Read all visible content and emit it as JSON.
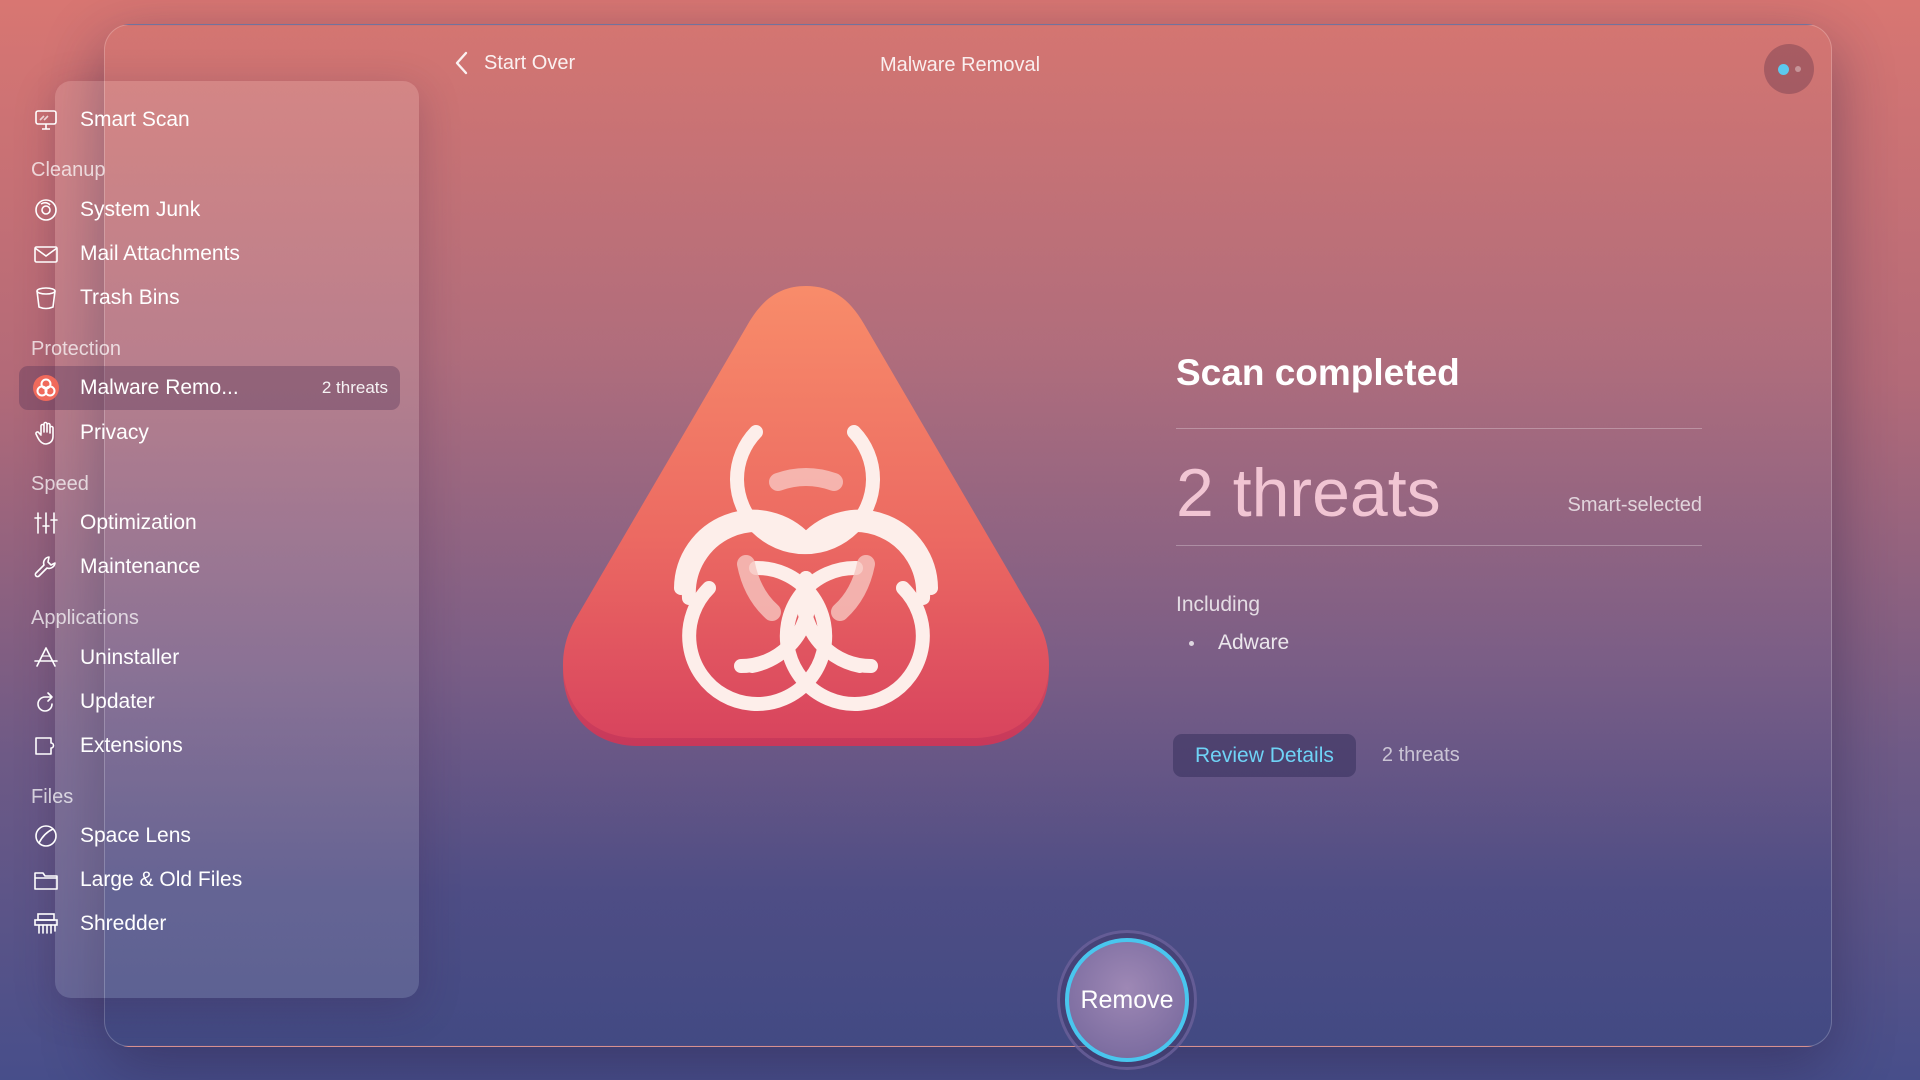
{
  "header": {
    "back_label": "Start Over",
    "title": "Malware Removal"
  },
  "sidebar": {
    "smart_scan": "Smart Scan",
    "sections": {
      "cleanup": "Cleanup",
      "protection": "Protection",
      "speed": "Speed",
      "applications": "Applications",
      "files": "Files"
    },
    "items": {
      "system_junk": "System Junk",
      "mail_attachments": "Mail Attachments",
      "trash_bins": "Trash Bins",
      "malware_removal": "Malware Remo...",
      "malware_badge": "2 threats",
      "privacy": "Privacy",
      "optimization": "Optimization",
      "maintenance": "Maintenance",
      "uninstaller": "Uninstaller",
      "updater": "Updater",
      "extensions": "Extensions",
      "space_lens": "Space Lens",
      "large_old_files": "Large & Old Files",
      "shredder": "Shredder"
    }
  },
  "results": {
    "title": "Scan completed",
    "threat_count": "2 threats",
    "smart_selected": "Smart-selected",
    "including_label": "Including",
    "threats": [
      "Adware"
    ],
    "review_button": "Review Details",
    "review_count": "2 threats"
  },
  "actions": {
    "remove_label": "Remove"
  },
  "colors": {
    "accent": "#49c6ee",
    "hero_top": "#f58a68",
    "hero_bottom": "#d9425f",
    "big_count": "#f1c5d3"
  }
}
